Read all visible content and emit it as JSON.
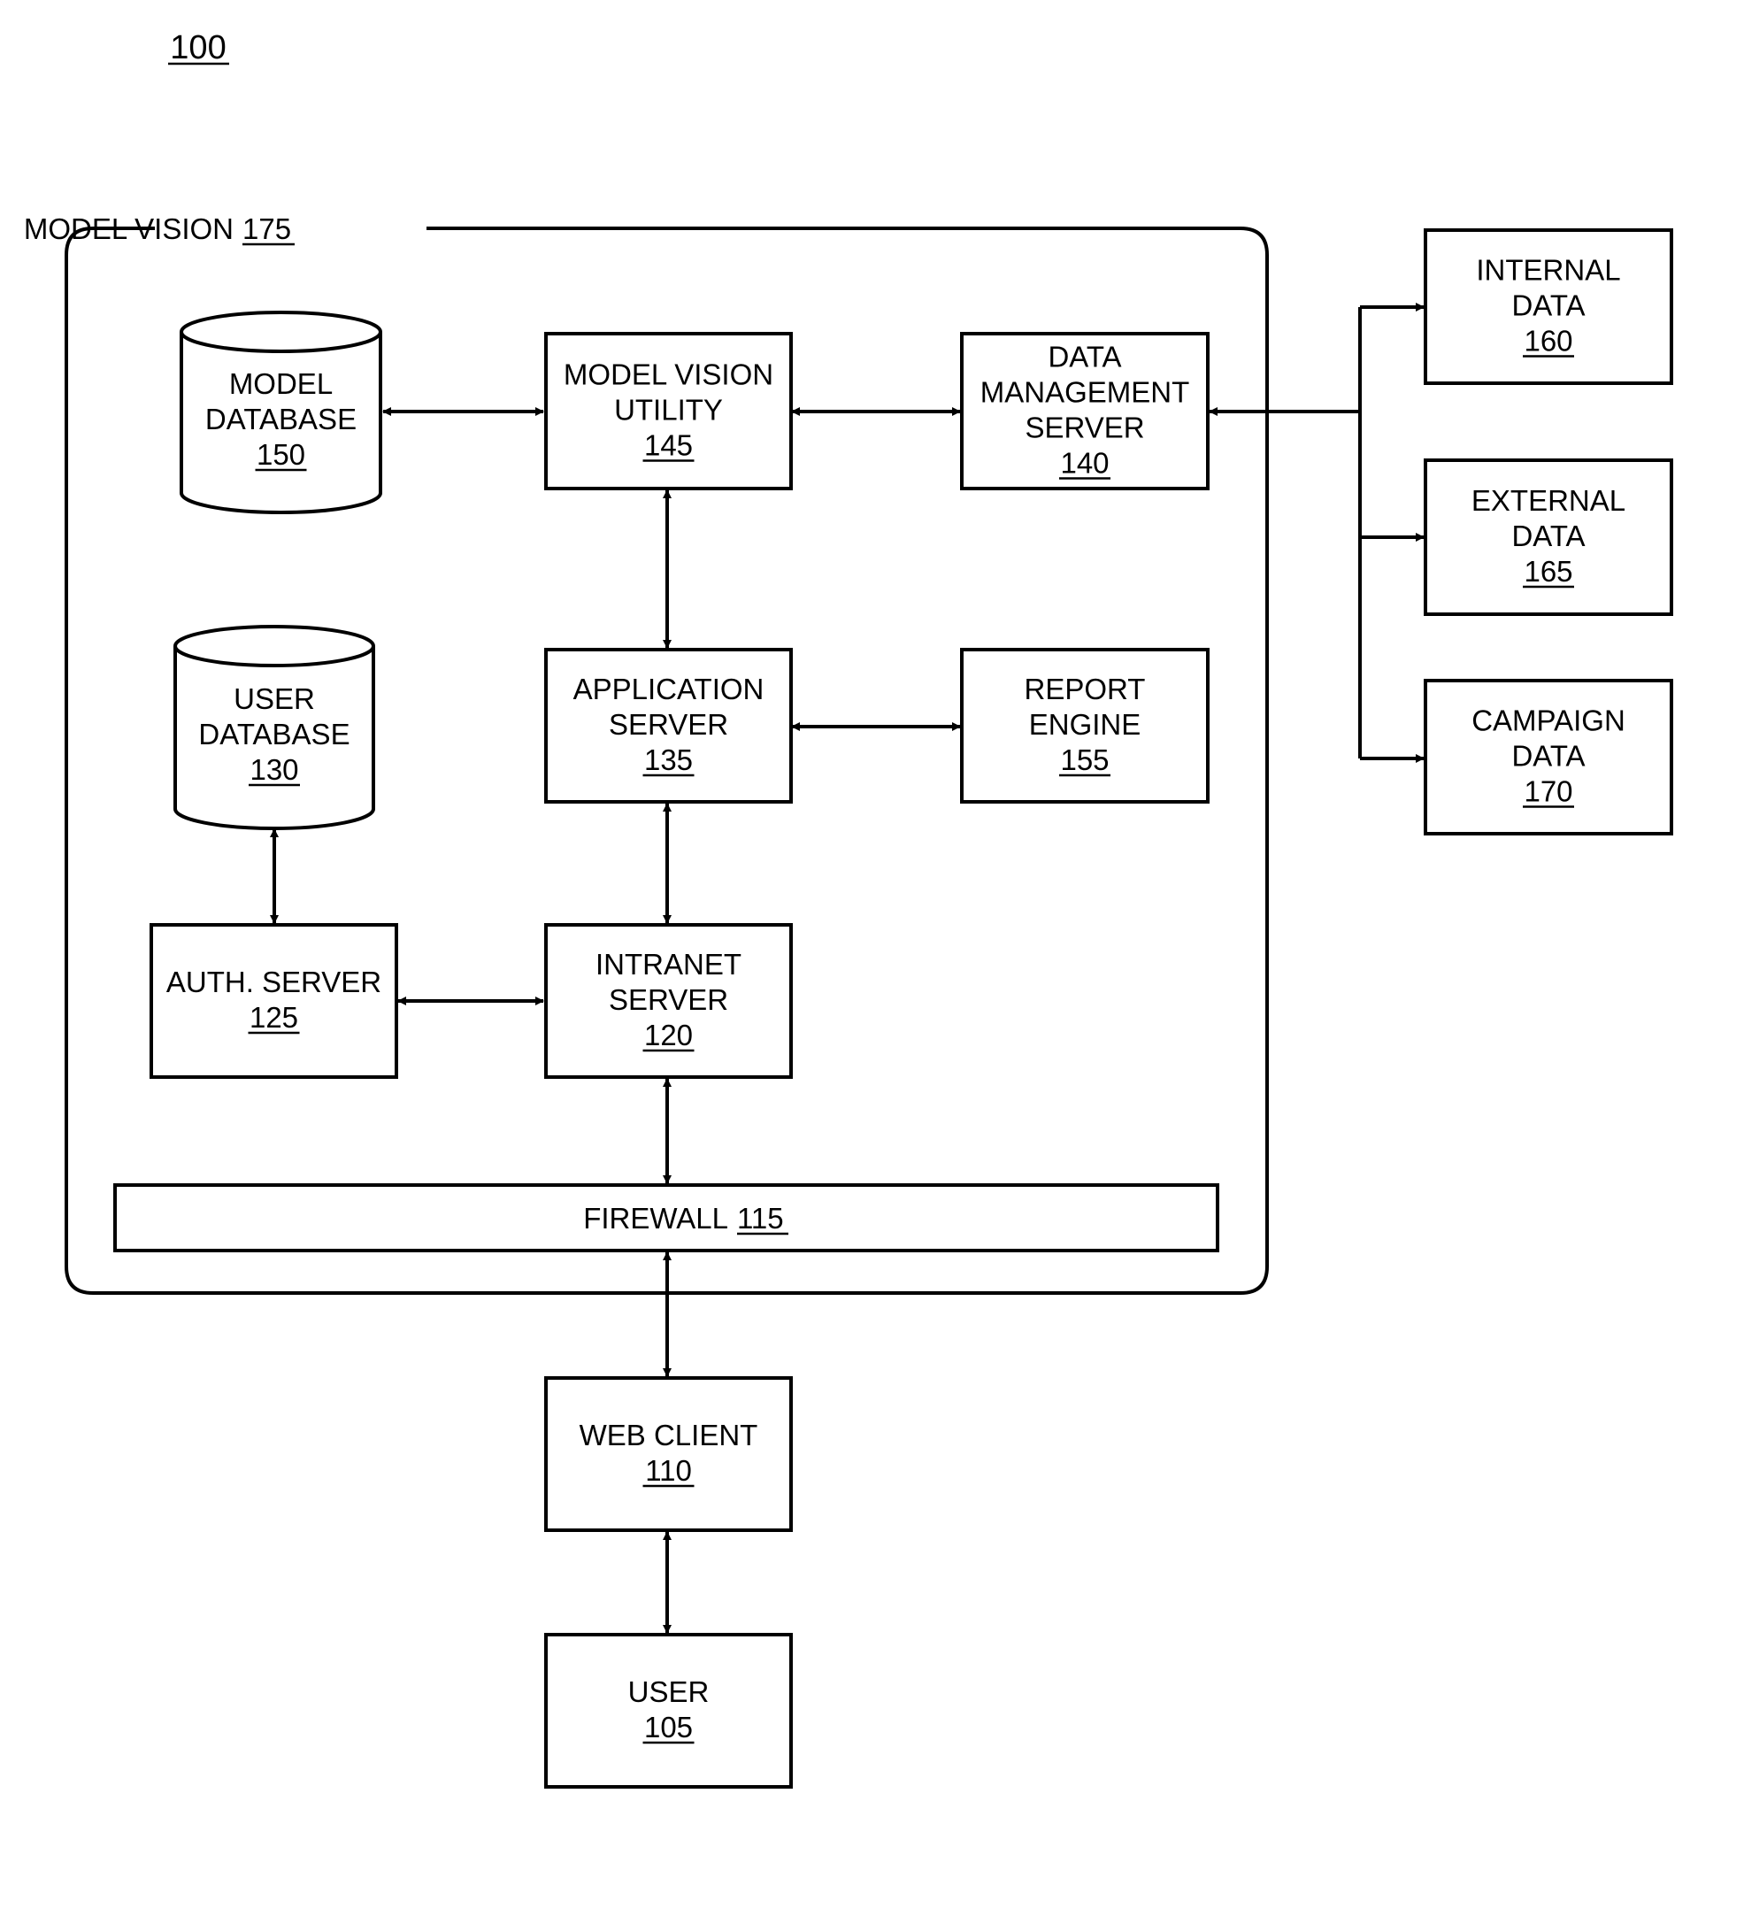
{
  "figure_label": "100",
  "container": {
    "title": "MODEL VISION",
    "ref": "175"
  },
  "nodes": {
    "model_database": {
      "lines": [
        "MODEL",
        "DATABASE"
      ],
      "ref": "150",
      "shape": "cylinder"
    },
    "model_vision_utility": {
      "lines": [
        "MODEL VISION",
        "UTILITY"
      ],
      "ref": "145",
      "shape": "box"
    },
    "data_management_server": {
      "lines": [
        "DATA",
        "MANAGEMENT",
        "SERVER"
      ],
      "ref": "140",
      "shape": "box"
    },
    "user_database": {
      "lines": [
        "USER",
        "DATABASE"
      ],
      "ref": "130",
      "shape": "cylinder"
    },
    "application_server": {
      "lines": [
        "APPLICATION",
        "SERVER"
      ],
      "ref": "135",
      "shape": "box"
    },
    "report_engine": {
      "lines": [
        "REPORT",
        "ENGINE"
      ],
      "ref": "155",
      "shape": "box"
    },
    "auth_server": {
      "lines": [
        "AUTH. SERVER"
      ],
      "ref": "125",
      "shape": "box"
    },
    "intranet_server": {
      "lines": [
        "INTRANET",
        "SERVER"
      ],
      "ref": "120",
      "shape": "box"
    },
    "firewall": {
      "lines": [
        "FIREWALL"
      ],
      "ref": "115",
      "shape": "bar"
    },
    "web_client": {
      "lines": [
        "WEB CLIENT"
      ],
      "ref": "110",
      "shape": "box"
    },
    "user": {
      "lines": [
        "USER"
      ],
      "ref": "105",
      "shape": "box"
    },
    "internal_data": {
      "lines": [
        "INTERNAL",
        "DATA"
      ],
      "ref": "160",
      "shape": "box"
    },
    "external_data": {
      "lines": [
        "EXTERNAL",
        "DATA"
      ],
      "ref": "165",
      "shape": "box"
    },
    "campaign_data": {
      "lines": [
        "CAMPAIGN",
        "DATA"
      ],
      "ref": "170",
      "shape": "box"
    }
  },
  "connections": [
    {
      "from": "model_database",
      "to": "model_vision_utility",
      "type": "bidirectional"
    },
    {
      "from": "model_vision_utility",
      "to": "data_management_server",
      "type": "bidirectional"
    },
    {
      "from": "model_vision_utility",
      "to": "application_server",
      "type": "bidirectional"
    },
    {
      "from": "application_server",
      "to": "report_engine",
      "type": "bidirectional"
    },
    {
      "from": "application_server",
      "to": "intranet_server",
      "type": "bidirectional"
    },
    {
      "from": "user_database",
      "to": "auth_server",
      "type": "bidirectional"
    },
    {
      "from": "auth_server",
      "to": "intranet_server",
      "type": "bidirectional"
    },
    {
      "from": "intranet_server",
      "to": "firewall",
      "type": "bidirectional"
    },
    {
      "from": "firewall",
      "to": "web_client",
      "type": "bidirectional"
    },
    {
      "from": "web_client",
      "to": "user",
      "type": "bidirectional"
    },
    {
      "from": "data_sources_bus",
      "to": "data_management_server",
      "type": "directed"
    },
    {
      "from": "data_sources_bus",
      "to": "internal_data",
      "type": "directed"
    },
    {
      "from": "data_sources_bus",
      "to": "external_data",
      "type": "directed"
    },
    {
      "from": "data_sources_bus",
      "to": "campaign_data",
      "type": "directed"
    }
  ]
}
